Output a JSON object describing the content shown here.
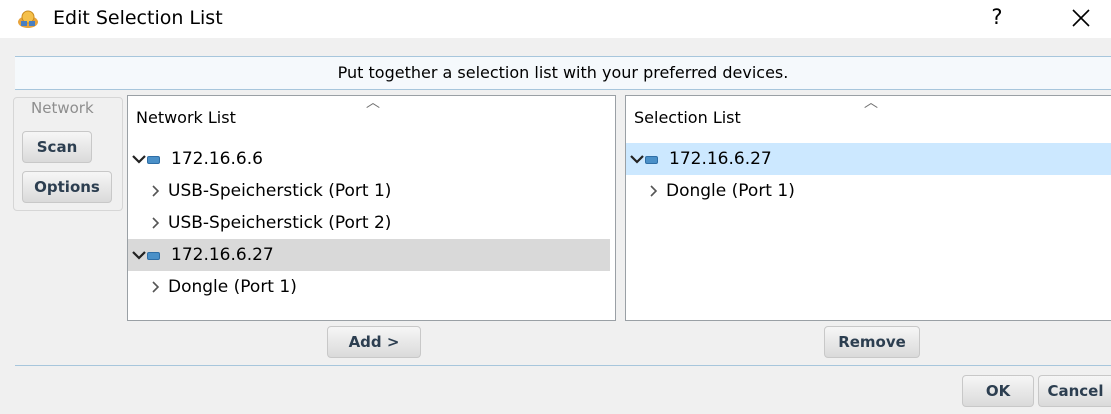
{
  "window": {
    "title": "Edit Selection List",
    "help_label": "?",
    "close_label": "✕"
  },
  "instruction": "Put together a selection list with your preferred devices.",
  "network_group": {
    "legend": "Network",
    "scan_label": "Scan",
    "options_label": "Options"
  },
  "network_list": {
    "title": "Network List",
    "items": [
      {
        "label": "172.16.6.6"
      },
      {
        "label": "USB-Speicherstick (Port 1)"
      },
      {
        "label": "USB-Speicherstick (Port 2)"
      },
      {
        "label": "172.16.6.27"
      },
      {
        "label": "Dongle (Port 1)"
      }
    ]
  },
  "selection_list": {
    "title": "Selection List",
    "items": [
      {
        "label": "172.16.6.27"
      },
      {
        "label": "Dongle (Port 1)"
      }
    ]
  },
  "buttons": {
    "add_label": "Add >",
    "remove_label": "Remove",
    "ok_label": "OK",
    "cancel_label": "Cancel"
  },
  "colors": {
    "accent_separator": "#a7c6dc",
    "row_highlight": "#d9d9d9",
    "row_selected": "#cce8ff"
  }
}
